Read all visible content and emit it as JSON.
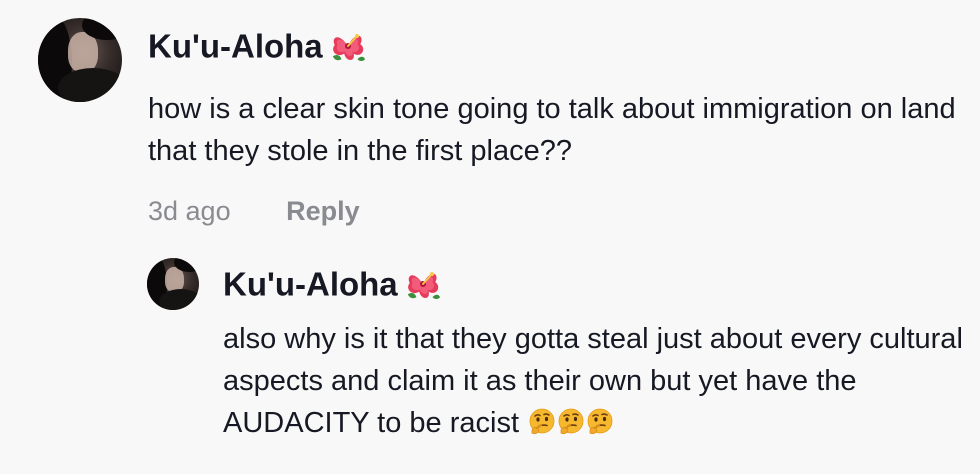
{
  "comments": [
    {
      "username": "Ku'u-Aloha",
      "username_emoji": "hibiscus-emoji",
      "text": "how is a clear skin tone going to talk about immigration on land that they stole in the first place??",
      "time": "3d ago",
      "reply_label": "Reply"
    }
  ],
  "replies": [
    {
      "username": "Ku'u-Aloha",
      "username_emoji": "hibiscus-emoji",
      "text": "also why is it that they gotta steal just about every cultural aspects and claim it as their own but yet have the AUDACITY to be racist ",
      "trailing_emojis": [
        "thinking-face-emoji",
        "thinking-face-emoji",
        "thinking-face-emoji"
      ]
    }
  ],
  "colors": {
    "background": "#f8f8f8",
    "text": "#161823",
    "muted": "#8a8b91"
  }
}
